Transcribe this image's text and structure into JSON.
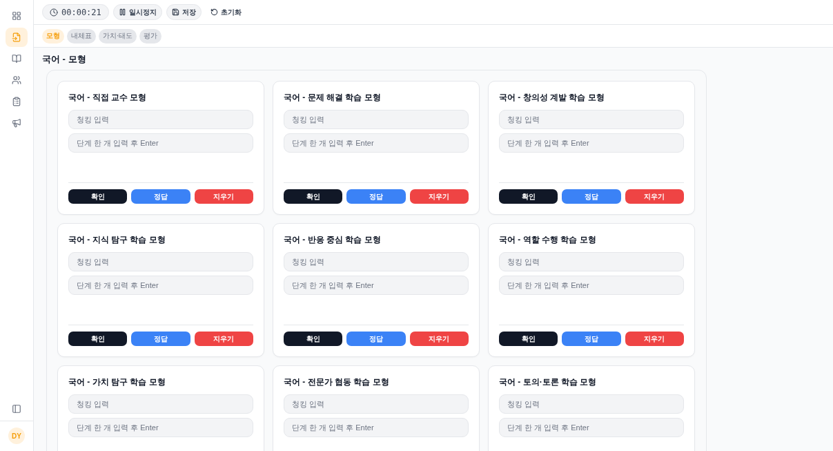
{
  "sidebar": {
    "items": [
      {
        "selected": false
      },
      {
        "selected": true
      },
      {
        "selected": false
      },
      {
        "selected": false
      },
      {
        "selected": false
      },
      {
        "selected": false
      }
    ],
    "avatar": "DY"
  },
  "toolbar": {
    "timer": "00:00:21",
    "buttons": [
      {
        "kind": "pause",
        "label": "일시정지"
      },
      {
        "kind": "save",
        "label": "저장"
      },
      {
        "kind": "reset",
        "label": "초기화"
      }
    ]
  },
  "tabs": [
    {
      "label": "모형",
      "selected": true
    },
    {
      "label": "내체표",
      "selected": false
    },
    {
      "label": "가치·태도",
      "selected": false
    },
    {
      "label": "평가",
      "selected": false
    }
  ],
  "section_title": "국어 - 모형",
  "cards": [
    {
      "title": "국어 - 직접 교수 모형",
      "fields": [
        {
          "placeholder": "청킹 입력"
        },
        {
          "placeholder": "단계 한 개 입력 후 Enter"
        }
      ],
      "buttons": [
        {
          "kind": "dark",
          "label": "확인"
        },
        {
          "kind": "blue",
          "label": "정답"
        },
        {
          "kind": "red",
          "label": "지우기"
        }
      ]
    },
    {
      "title": "국어 - 문제 해결 학습 모형",
      "fields": [
        {
          "placeholder": "청킹 입력"
        },
        {
          "placeholder": "단계 한 개 입력 후 Enter"
        }
      ],
      "buttons": [
        {
          "kind": "dark",
          "label": "확인"
        },
        {
          "kind": "blue",
          "label": "정답"
        },
        {
          "kind": "red",
          "label": "지우기"
        }
      ]
    },
    {
      "title": "국어 - 창의성 계발 학습 모형",
      "fields": [
        {
          "placeholder": "청킹 입력"
        },
        {
          "placeholder": "단계 한 개 입력 후 Enter"
        }
      ],
      "buttons": [
        {
          "kind": "dark",
          "label": "확인"
        },
        {
          "kind": "blue",
          "label": "정답"
        },
        {
          "kind": "red",
          "label": "지우기"
        }
      ]
    },
    {
      "title": "국어 - 지식 탐구 학습 모형",
      "fields": [
        {
          "placeholder": "청킹 입력"
        },
        {
          "placeholder": "단계 한 개 입력 후 Enter"
        }
      ],
      "buttons": [
        {
          "kind": "dark",
          "label": "확인"
        },
        {
          "kind": "blue",
          "label": "정답"
        },
        {
          "kind": "red",
          "label": "지우기"
        }
      ]
    },
    {
      "title": "국어 - 반응 중심 학습 모형",
      "fields": [
        {
          "placeholder": "청킹 입력"
        },
        {
          "placeholder": "단계 한 개 입력 후 Enter"
        }
      ],
      "buttons": [
        {
          "kind": "dark",
          "label": "확인"
        },
        {
          "kind": "blue",
          "label": "정답"
        },
        {
          "kind": "red",
          "label": "지우기"
        }
      ]
    },
    {
      "title": "국어 - 역할 수행 학습 모형",
      "fields": [
        {
          "placeholder": "청킹 입력"
        },
        {
          "placeholder": "단계 한 개 입력 후 Enter"
        }
      ],
      "buttons": [
        {
          "kind": "dark",
          "label": "확인"
        },
        {
          "kind": "blue",
          "label": "정답"
        },
        {
          "kind": "red",
          "label": "지우기"
        }
      ]
    },
    {
      "title": "국어 - 가치 탐구 학습 모형",
      "fields": [
        {
          "placeholder": "청킹 입력"
        },
        {
          "placeholder": "단계 한 개 입력 후 Enter"
        }
      ]
    },
    {
      "title": "국어 - 전문가 협동 학습 모형",
      "fields": [
        {
          "placeholder": "청킹 입력"
        },
        {
          "placeholder": "단계 한 개 입력 후 Enter"
        }
      ]
    },
    {
      "title": "국어 - 토의·토론 학습 모형",
      "fields": [
        {
          "placeholder": "청킹 입력"
        },
        {
          "placeholder": "단계 한 개 입력 후 Enter"
        }
      ]
    }
  ]
}
